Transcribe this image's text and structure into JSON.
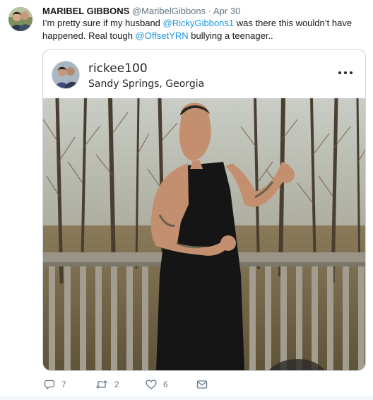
{
  "tweet": {
    "display_name": "MARIBEL GIBBONS",
    "handle": "@MaribelGibbons",
    "separator": "·",
    "date": "Apr 30",
    "text_part1": "I’m pretty sure if my husband ",
    "mention1": "@RickyGibbons1",
    "text_part2": " was there this wouldn’t have happened. Real tough ",
    "mention2": "@OffsetYRN",
    "text_part3": " bullying a teenager.."
  },
  "embed": {
    "username": "rickee100",
    "location": "Sandy Springs, Georgia",
    "more_icon": "more-horizontal-icon"
  },
  "actions": {
    "reply_count": "7",
    "retweet_count": "2",
    "like_count": "6"
  },
  "colors": {
    "link": "#1b95e0",
    "secondary_text": "#657786",
    "border": "#ccd6dd"
  }
}
